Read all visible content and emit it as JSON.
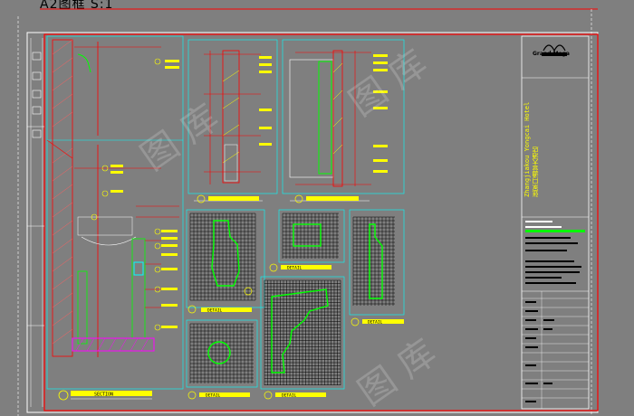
{
  "window": {
    "title": "A2图框 S:1"
  },
  "drawing": {
    "labels": {
      "detail": "DETAIL",
      "section": "SECTION"
    },
    "title_block": {
      "brand": "Grand Mega",
      "project_en": "Zhangjiakou Yongcai Hotel",
      "project_cn": "张家口通营大酒店"
    },
    "watermark": "图 库",
    "colors": {
      "background": "#7f7f7f",
      "frame": "#ff0000",
      "cyan": "#00ffff",
      "yellow": "#ffff00",
      "green": "#00ff00",
      "white": "#ffffff",
      "magenta": "#ff00ff"
    }
  }
}
